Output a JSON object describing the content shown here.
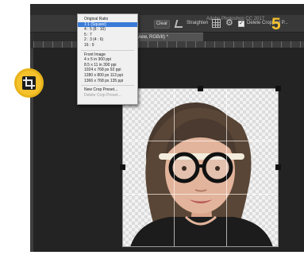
{
  "app": {
    "title": "Adobe Photoshop CC 2017"
  },
  "options_bar": {
    "clear_label": "Clear",
    "straighten_label": "Straighten",
    "delete_cropped_label": "Delete Cropped P..."
  },
  "document_tab": {
    "label": "…% (Crop Preview, RGB/8) *"
  },
  "crop_menu": {
    "items": [
      {
        "label": "Original Ratio",
        "state": "normal"
      },
      {
        "label": "1:1 (Square)",
        "state": "selected"
      },
      {
        "label": "4 : 5 (8 : 10)",
        "state": "normal"
      },
      {
        "label": "5 : 7",
        "state": "normal"
      },
      {
        "label": "2 : 3 (4 : 6)",
        "state": "normal"
      },
      {
        "label": "16 : 9",
        "state": "normal"
      },
      {
        "label": "Front Image",
        "state": "normal"
      },
      {
        "label": "4 x 5 in 300 ppi",
        "state": "normal"
      },
      {
        "label": "8.5 x 11 in 300 ppi",
        "state": "normal"
      },
      {
        "label": "1024 x 768 px 92 ppi",
        "state": "normal"
      },
      {
        "label": "1280 x 800 px 113 ppi",
        "state": "normal"
      },
      {
        "label": "1366 x 768 px 135 ppi",
        "state": "normal"
      },
      {
        "label": "New Crop Preset...",
        "state": "normal"
      },
      {
        "label": "Delete Crop Preset...",
        "state": "disabled"
      }
    ]
  },
  "annotation": {
    "step": "5",
    "highlight_color": "#f5c22d"
  },
  "icons": {
    "crop_tool": "crop-icon",
    "settings": "gear-icon",
    "grid_overlay": "grid-overlay-icon",
    "straighten": "straighten-icon"
  }
}
